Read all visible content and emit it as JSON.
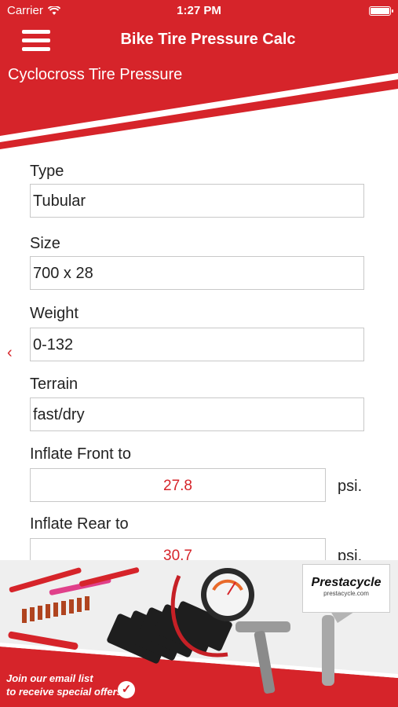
{
  "colors": {
    "accent": "#d6242a",
    "white": "#ffffff"
  },
  "status_bar": {
    "carrier": "Carrier",
    "time": "1:27 PM",
    "battery_level": 1.0
  },
  "nav": {
    "title": "Bike Tire Pressure Calc",
    "menu_icon": "hamburger-menu-icon"
  },
  "page": {
    "subtitle": "Cyclocross Tire Pressure"
  },
  "form": {
    "type": {
      "label": "Type",
      "value": "Tubular"
    },
    "size": {
      "label": "Size",
      "value": "700 x 28"
    },
    "weight": {
      "label": "Weight",
      "value": "0-132"
    },
    "terrain": {
      "label": "Terrain",
      "value": "fast/dry"
    },
    "inflate_front": {
      "label": "Inflate Front to",
      "value": "27.8",
      "unit": "psi."
    },
    "inflate_rear": {
      "label": "Inflate Rear to",
      "value": "30.7",
      "unit": "psi."
    }
  },
  "side_nav": {
    "chevron": "‹"
  },
  "ad": {
    "brand": "Prestacycle",
    "url": "prestacycle.com",
    "text_line1": "Join our email list",
    "text_line2": "to receive special offers!",
    "check_icon": "✓"
  }
}
